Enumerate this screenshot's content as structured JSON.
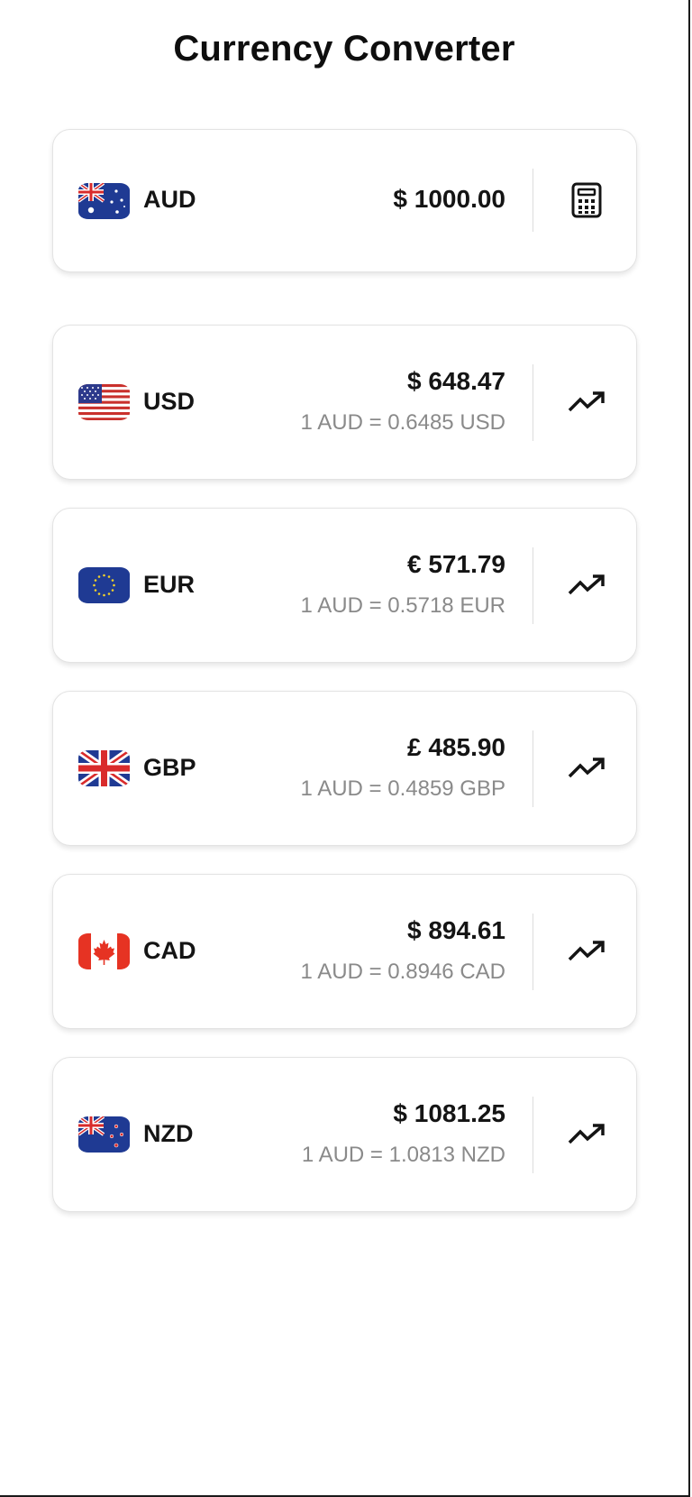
{
  "title": "Currency Converter",
  "base": {
    "code": "AUD",
    "amount": "$ 1000.00",
    "flag": "australia-flag",
    "action_icon": "calculator-icon"
  },
  "targets": [
    {
      "code": "USD",
      "amount": "$ 648.47",
      "rate": "1 AUD = 0.6485 USD",
      "flag": "usa-flag",
      "action_icon": "trending-up-icon"
    },
    {
      "code": "EUR",
      "amount": "€ 571.79",
      "rate": "1 AUD = 0.5718 EUR",
      "flag": "eu-flag",
      "action_icon": "trending-up-icon"
    },
    {
      "code": "GBP",
      "amount": "£ 485.90",
      "rate": "1 AUD = 0.4859 GBP",
      "flag": "uk-flag",
      "action_icon": "trending-up-icon"
    },
    {
      "code": "CAD",
      "amount": "$ 894.61",
      "rate": "1 AUD = 0.8946 CAD",
      "flag": "canada-flag",
      "action_icon": "trending-up-icon"
    },
    {
      "code": "NZD",
      "amount": "$ 1081.25",
      "rate": "1 AUD = 1.0813 NZD",
      "flag": "new-zealand-flag",
      "action_icon": "trending-up-icon"
    }
  ],
  "colors": {
    "text": "#141414",
    "muted": "#8a8a8a",
    "card_border": "#e3e3e3"
  }
}
